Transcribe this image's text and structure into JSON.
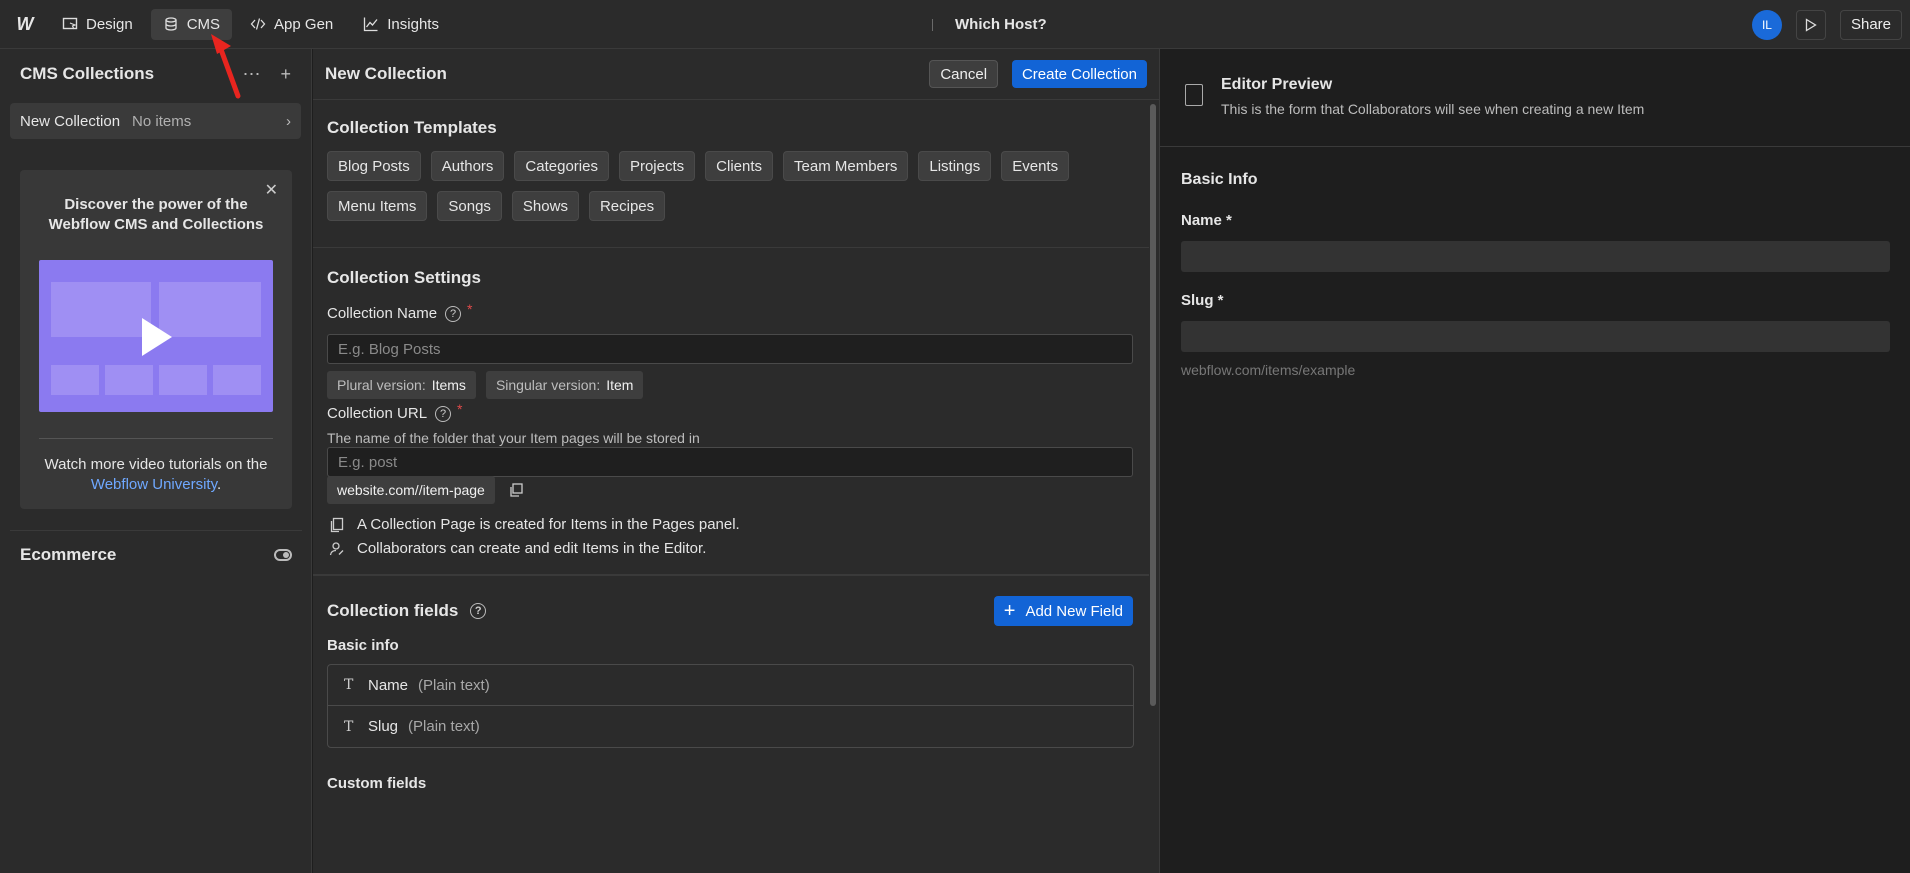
{
  "topbar": {
    "logo": "W",
    "tabs": [
      {
        "label": "Design"
      },
      {
        "label": "CMS"
      },
      {
        "label": "App Gen"
      },
      {
        "label": "Insights"
      }
    ],
    "site_name": "Which Host?",
    "avatar_initials": "IL",
    "share_label": "Share"
  },
  "sidebar": {
    "title": "CMS Collections",
    "collection": {
      "name": "New Collection",
      "status": "No items"
    },
    "promo": {
      "heading": "Discover the power of the Webflow CMS and Collections",
      "footer_text": "Watch more video tutorials on the",
      "footer_link": "Webflow University",
      "footer_end": "."
    },
    "ecommerce_label": "Ecommerce"
  },
  "main": {
    "title": "New Collection",
    "cancel_label": "Cancel",
    "create_label": "Create Collection",
    "templates": {
      "title": "Collection Templates",
      "items": [
        "Blog Posts",
        "Authors",
        "Categories",
        "Projects",
        "Clients",
        "Team Members",
        "Listings",
        "Events",
        "Menu Items",
        "Songs",
        "Shows",
        "Recipes"
      ]
    },
    "settings": {
      "title": "Collection Settings",
      "name_label": "Collection Name",
      "name_placeholder": "E.g. Blog Posts",
      "plural_label": "Plural version:",
      "plural_value": "Items",
      "singular_label": "Singular version:",
      "singular_value": "Item",
      "url_label": "Collection URL",
      "url_helper": "The name of the folder that your Item pages will be stored in",
      "url_placeholder": "E.g. post",
      "url_preview": "website.com//item-page",
      "info_1": "A Collection Page is created for Items in the Pages panel.",
      "info_2": "Collaborators can create and edit Items in the Editor."
    },
    "fields": {
      "title": "Collection fields",
      "add_label": "Add New Field",
      "basic_title": "Basic info",
      "basic": [
        {
          "name": "Name",
          "type": "(Plain text)"
        },
        {
          "name": "Slug",
          "type": "(Plain text)"
        }
      ],
      "custom_title": "Custom fields"
    }
  },
  "preview": {
    "title": "Editor Preview",
    "subtitle": "This is the form that Collaborators will see when creating a new Item",
    "section": "Basic Info",
    "name_label": "Name *",
    "slug_label": "Slug *",
    "slug_hint": "webflow.com/items/example"
  },
  "colors": {
    "accent": "#1264d6",
    "annotation_arrow": "#e8251f"
  }
}
